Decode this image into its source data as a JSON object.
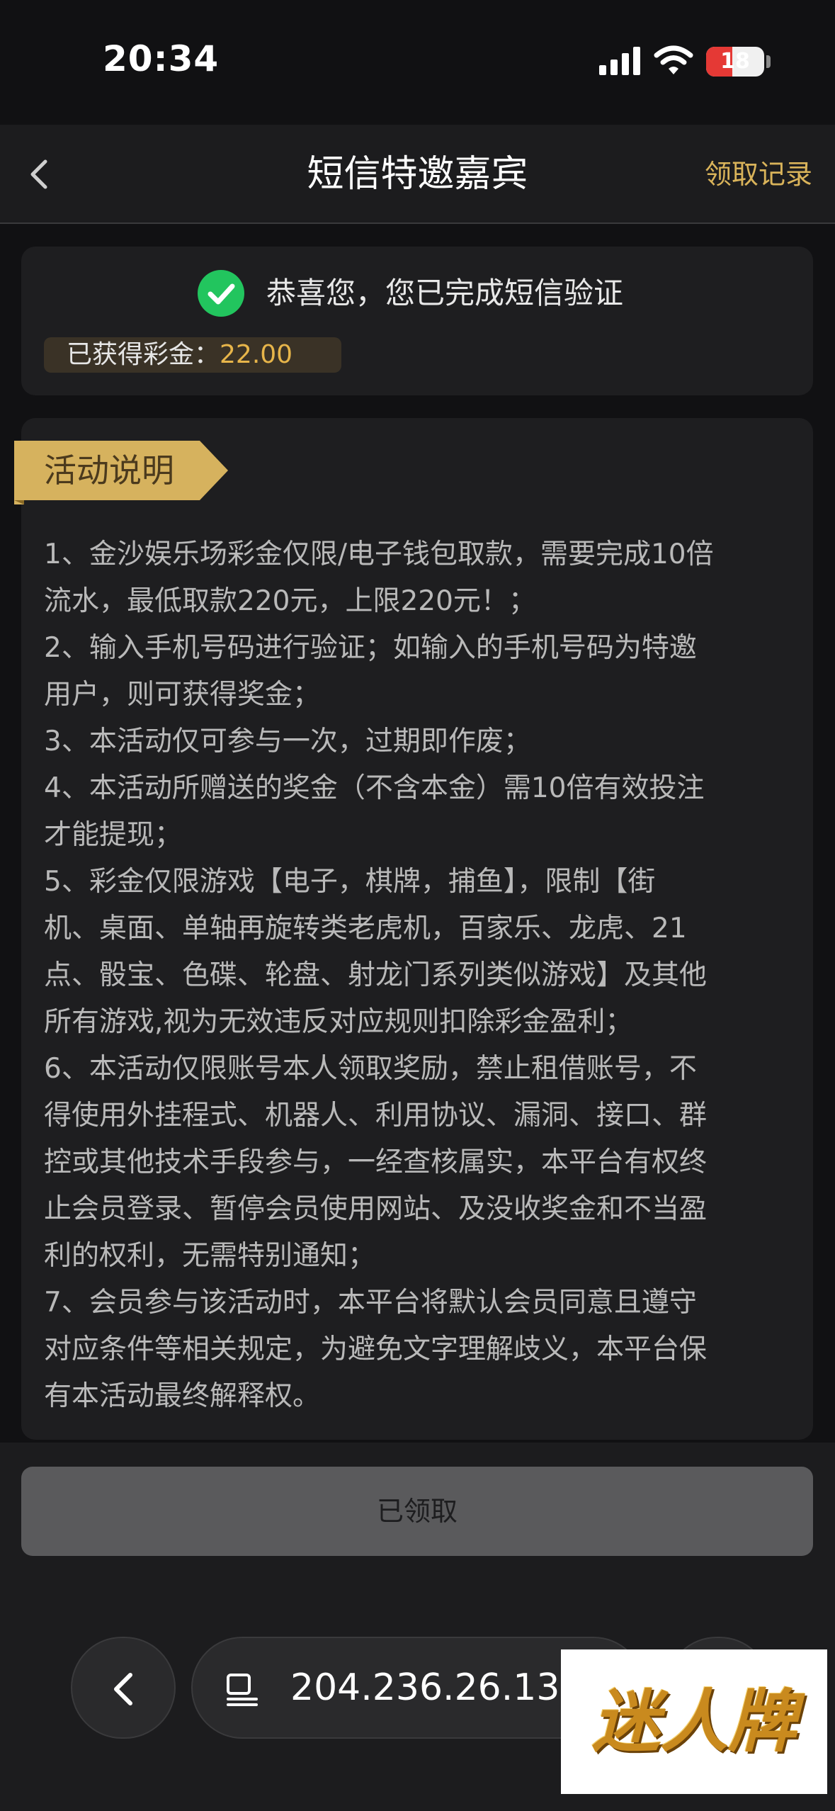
{
  "status_bar": {
    "time": "20:34",
    "battery_level": "18",
    "battery_percent": 18,
    "icons": [
      "signal-icon",
      "wifi-icon",
      "battery-icon"
    ]
  },
  "header": {
    "title": "短信特邀嘉宾",
    "record_link": "领取记录"
  },
  "success": {
    "message": "恭喜您，您已完成短信验证",
    "bonus_label": "已获得彩金：",
    "bonus_value": "22.00"
  },
  "rules": {
    "tag": "活动说明",
    "lines": [
      "1、金沙娱乐场彩金仅限/电子钱包取款，需要完成10倍",
      "流水，最低取款220元，上限220元！；",
      "2、输入手机号码进行验证；如输入的手机号码为特邀",
      "用户，则可获得奖金；",
      "3、本活动仅可参与一次，过期即作废；",
      "4、本活动所赠送的奖金（不含本金）需10倍有效投注",
      "才能提现；",
      "5、彩金仅限游戏【电子，棋牌，捕鱼】，限制【街",
      "机、桌面、单轴再旋转类老虎机，百家乐、龙虎、21",
      "点、骰宝、色碟、轮盘、射龙门系列类似游戏】及其他",
      "所有游戏,视为无效违反对应规则扣除彩金盈利；",
      "6、本活动仅限账号本人领取奖励，禁止租借账号，不",
      "得使用外挂程式、机器人、利用协议、漏洞、接口、群",
      "控或其他技术手段参与，一经查核属实，本平台有权终",
      "止会员登录、暂停会员使用网站、及没收奖金和不当盈",
      "利的权利，无需特别通知；",
      "7、会员参与该活动时，本平台将默认会员同意且遵守",
      "对应条件等相关规定，为避免文字理解歧义，本平台保",
      "有本活动最终解释权。"
    ]
  },
  "claim_button": {
    "label": "已领取"
  },
  "browser": {
    "url": "204.236.26.134"
  },
  "watermark": {
    "text": "迷人牌"
  },
  "colors": {
    "accent_gold": "#d9b35a",
    "bonus_gold": "#e7b54a",
    "success_green": "#22c55e",
    "battery_red": "#e53935"
  }
}
